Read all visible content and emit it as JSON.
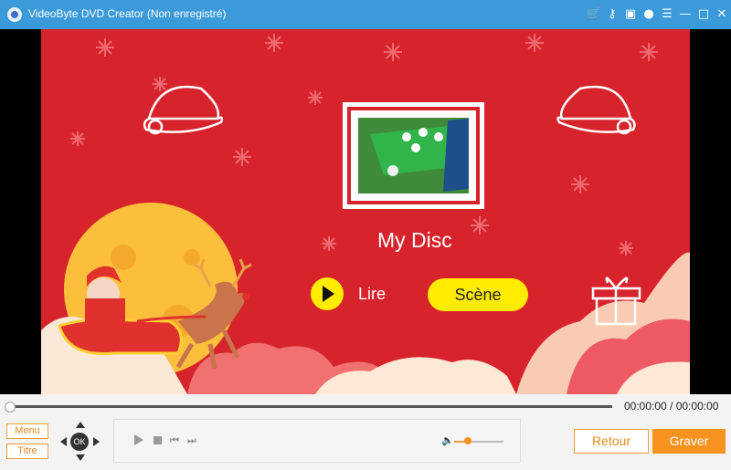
{
  "window": {
    "title": "VideoByte DVD Creator (Non enregistré)",
    "buttons": [
      "cart-icon",
      "key-icon",
      "save-icon",
      "chat-icon",
      "feedback-icon",
      "minimize-icon",
      "maximize-icon",
      "close-icon"
    ]
  },
  "menu_preview": {
    "disc_title": "My Disc",
    "play_label": "Lire",
    "scene_label": "Scène"
  },
  "playback": {
    "time": "00:00:00 / 00:00:00",
    "progress": 0,
    "volume": 0.3
  },
  "nav": {
    "menu_label": "Menu",
    "title_label": "Titre",
    "ok_label": "OK"
  },
  "actions": {
    "back_label": "Retour",
    "burn_label": "Graver"
  },
  "colors": {
    "titlebar": "#3b9ad9",
    "background_red": "#d7232b",
    "accent_orange": "#f79120",
    "button_yellow": "#ffec00"
  }
}
